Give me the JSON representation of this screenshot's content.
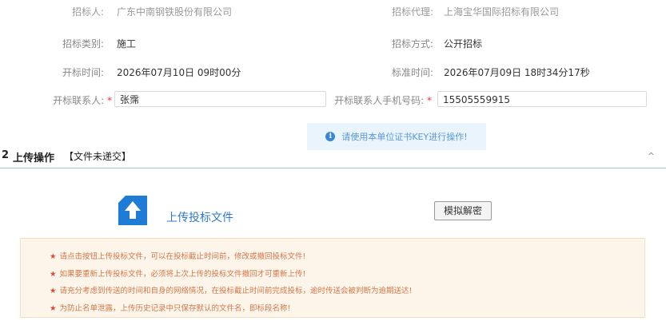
{
  "info": {
    "tenderer_label": "招标人:",
    "tenderer_value": "广东中南钢铁股份有限公司",
    "agency_label": "招标代理:",
    "agency_value": "上海宝华国际招标有限公司",
    "category_label": "招标类别:",
    "category_value": "施工",
    "method_label": "招标方式:",
    "method_value": "公开招标",
    "open_time_label": "开标时间:",
    "open_time_value": "2026年07月10日 09时00分",
    "std_time_label": "标准时间:",
    "std_time_value": "2026年07月09日 18时34分17秒",
    "contact_label": "开标联系人:",
    "contact_value": "张霈",
    "phone_label": "开标联系人手机号码:",
    "phone_value": "15505559915",
    "required_mark": "*"
  },
  "notice": {
    "icon": "info-icon",
    "text": "请使用本单位证书KEY进行操作!"
  },
  "section": {
    "number": "2",
    "title": "上传操作",
    "status": "【文件未递交】",
    "collapse_icon": "chevron-up-icon",
    "collapse_glyph": "^"
  },
  "upload": {
    "icon": "upload-arrow-icon",
    "label": "上传投标文件",
    "decrypt_button": "模拟解密"
  },
  "warnings": [
    "请点击按钮上传投标文件，可以在投标截止时间前，修改或撤回投标文件!",
    "如果要重新上传投标文件，必须将上次上传的投标文件撤回才可重新上传!",
    "请充分考虑到传送的时间和自身的网络情况，在投标截止时间前完成投标，逾时传送会被判断为逾期送达!",
    "为防止名单泄露，上传历史记录中只保存默认的文件名，即标段名称!"
  ],
  "warning_star": "★",
  "colors": {
    "accent_blue": "#1e7bd6",
    "notice_bg": "#eaf4fd",
    "warning_bg": "#fdf5ea",
    "warning_text": "#d2784a",
    "required_red": "#e33333"
  }
}
